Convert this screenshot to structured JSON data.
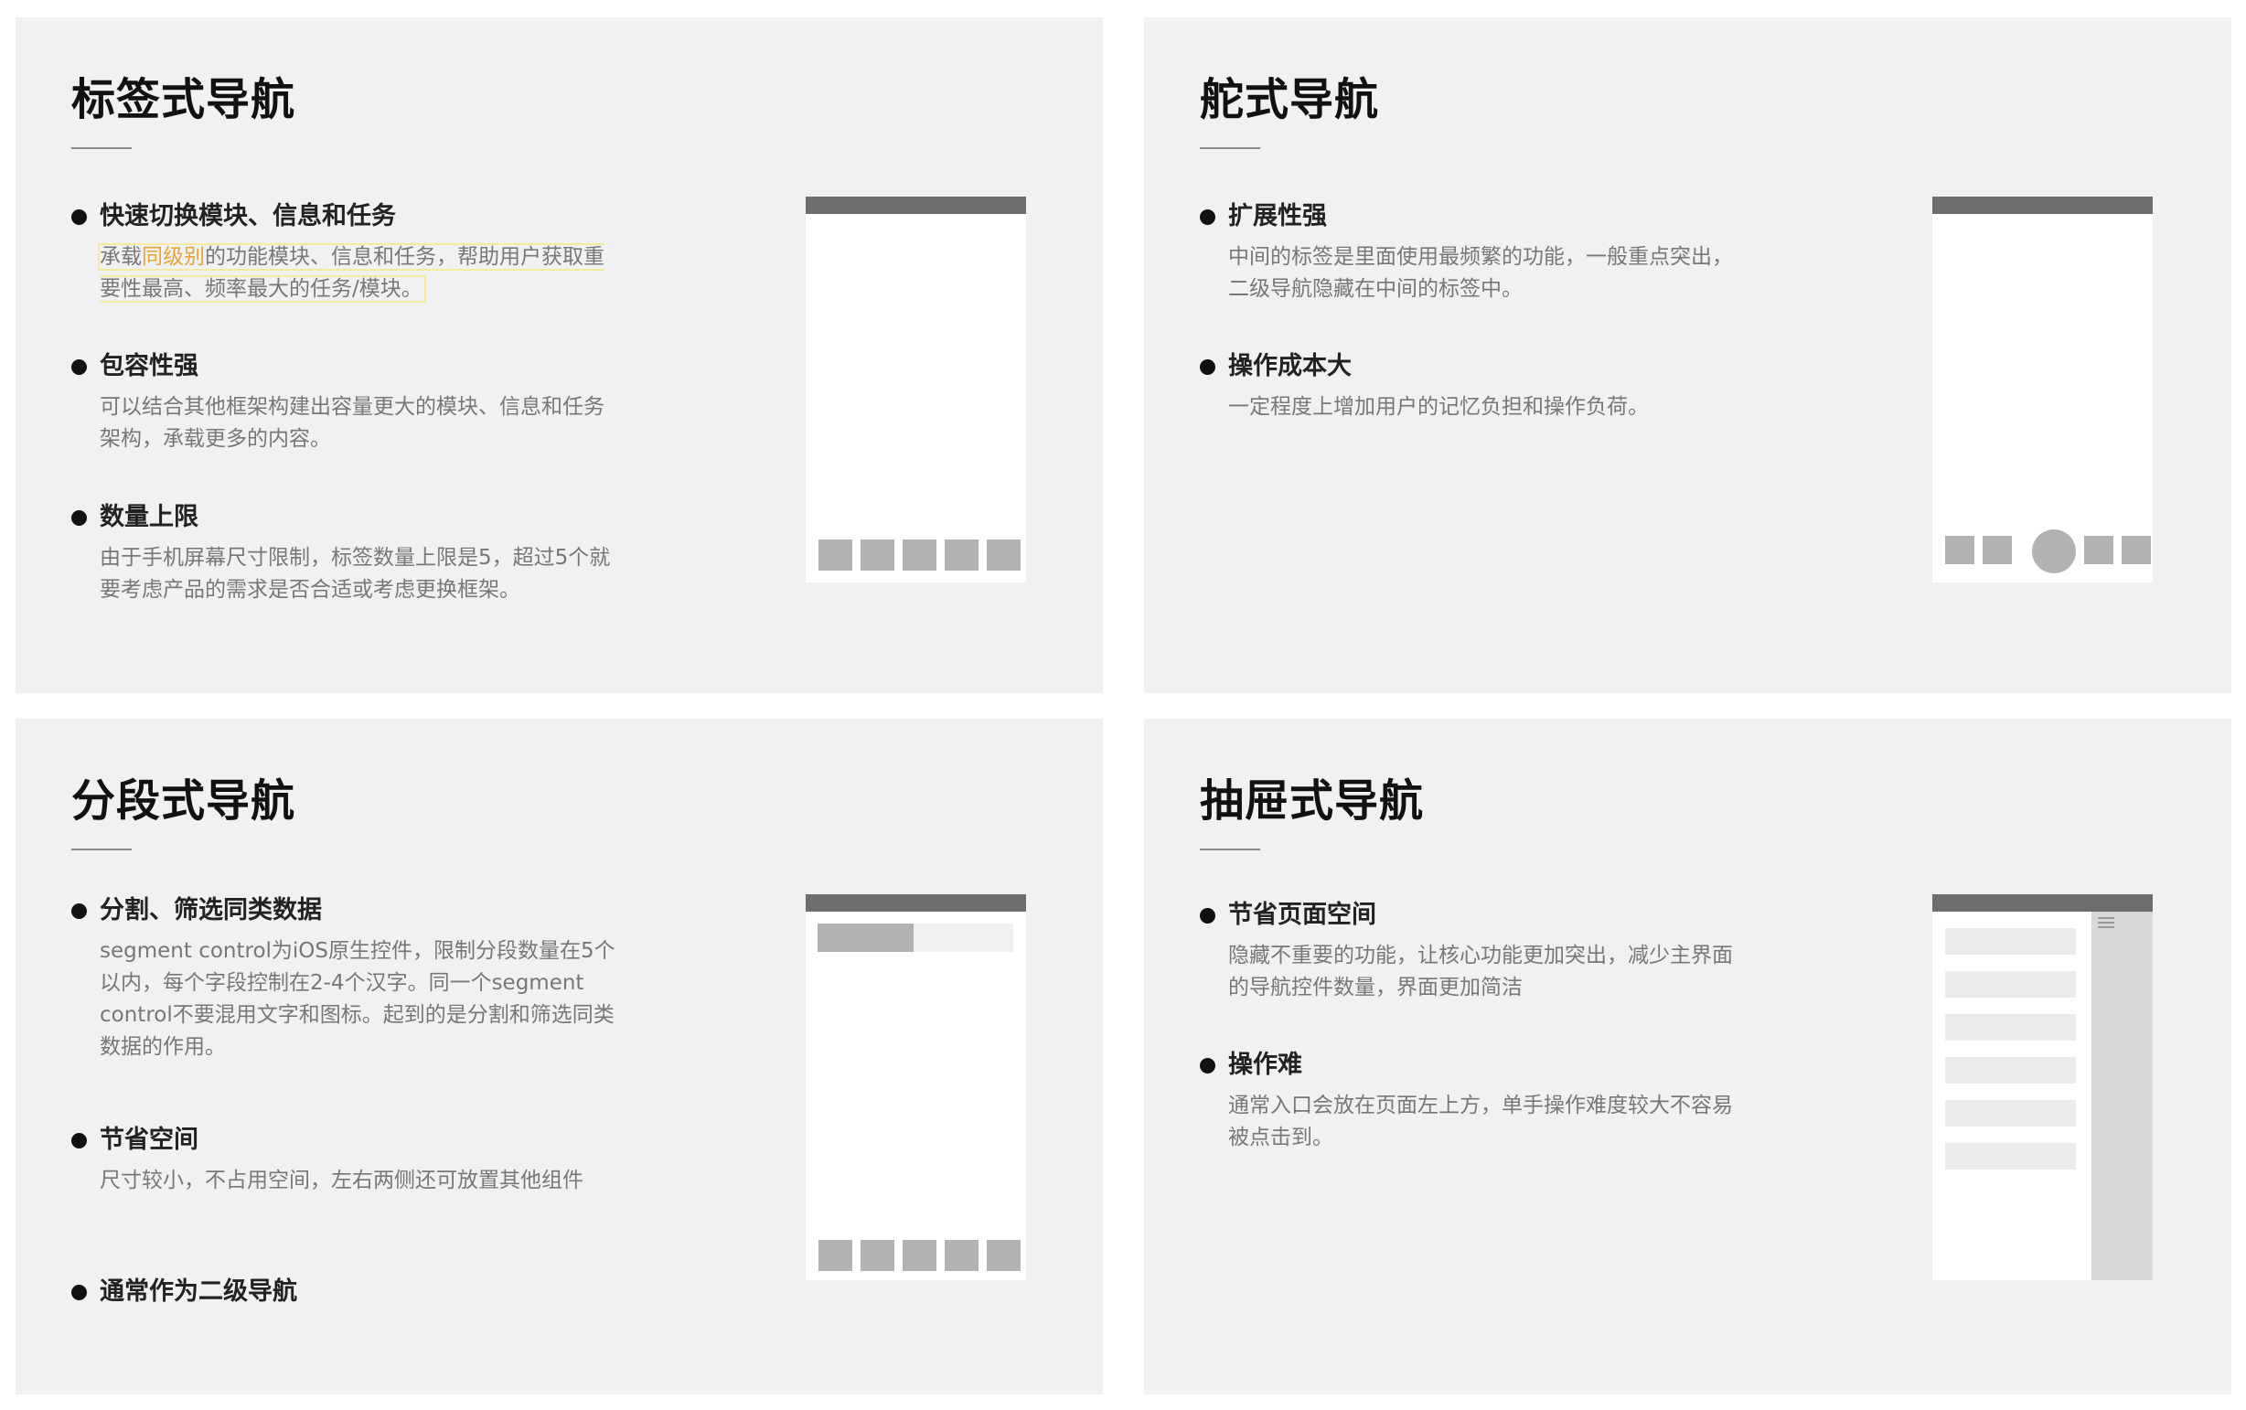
{
  "panels": [
    {
      "title": "标签式导航",
      "bullets": [
        {
          "heading": "快速切换模块、信息和任务",
          "desc_pre": "承载",
          "desc_hl": "同级别",
          "desc_post": "的功能模块、信息和任务，帮助用户获取重要性最高、频率最大的任务/模块。"
        },
        {
          "heading": "包容性强",
          "desc": "可以结合其他框架构建出容量更大的模块、信息和任务架构，承载更多的内容。"
        },
        {
          "heading": "数量上限",
          "desc": "由于手机屏幕尺寸限制，标签数量上限是5，超过5个就要考虑产品的需求是否合适或考虑更换框架。"
        }
      ]
    },
    {
      "title": "舵式导航",
      "bullets": [
        {
          "heading": "扩展性强",
          "desc": "中间的标签是里面使用最频繁的功能，一般重点突出，二级导航隐藏在中间的标签中。"
        },
        {
          "heading": "操作成本大",
          "desc": "一定程度上增加用户的记忆负担和操作负荷。"
        }
      ]
    },
    {
      "title": "分段式导航",
      "bullets": [
        {
          "heading": "分割、筛选同类数据",
          "desc": "segment control为iOS原生控件，限制分段数量在5个以内，每个字段控制在2-4个汉字。同一个segment control不要混用文字和图标。起到的是分割和筛选同类数据的作用。"
        },
        {
          "heading": "节省空间",
          "desc": "尺寸较小，不占用空间，左右两侧还可放置其他组件"
        },
        {
          "heading": "通常作为二级导航"
        }
      ]
    },
    {
      "title": "抽屉式导航",
      "bullets": [
        {
          "heading": "节省页面空间",
          "desc": "隐藏不重要的功能，让核心功能更加突出，减少主界面的导航控件数量，界面更加简洁"
        },
        {
          "heading": "操作难",
          "desc": "通常入口会放在页面左上方，单手操作难度较大不容易被点击到。"
        }
      ]
    }
  ],
  "colors": {
    "panel_bg": "#f1f1f1",
    "highlight_text": "#e5a53a",
    "highlight_border": "#f5eaa3",
    "mock_status_bar": "#6d6d6d",
    "mock_placeholder": "#b2b2b2"
  },
  "icons": {
    "drawer_menu": "list-icon"
  }
}
